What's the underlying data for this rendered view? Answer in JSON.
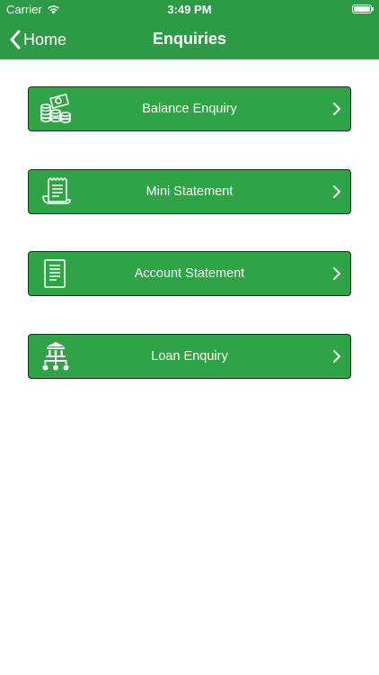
{
  "status_bar": {
    "carrier": "Carrier",
    "time": "3:49 PM"
  },
  "nav": {
    "back_label": "Home",
    "title": "Enquiries"
  },
  "menu": {
    "items": [
      {
        "label": "Balance Enquiry",
        "icon": "money-coins-icon"
      },
      {
        "label": "Mini Statement",
        "icon": "receipt-icon"
      },
      {
        "label": "Account Statement",
        "icon": "document-icon"
      },
      {
        "label": "Loan Enquiry",
        "icon": "bank-network-icon"
      }
    ]
  },
  "colors": {
    "header": "#2d9a45",
    "button": "#2ea447",
    "button_border": "#1f2b22",
    "text": "#ffffff"
  }
}
